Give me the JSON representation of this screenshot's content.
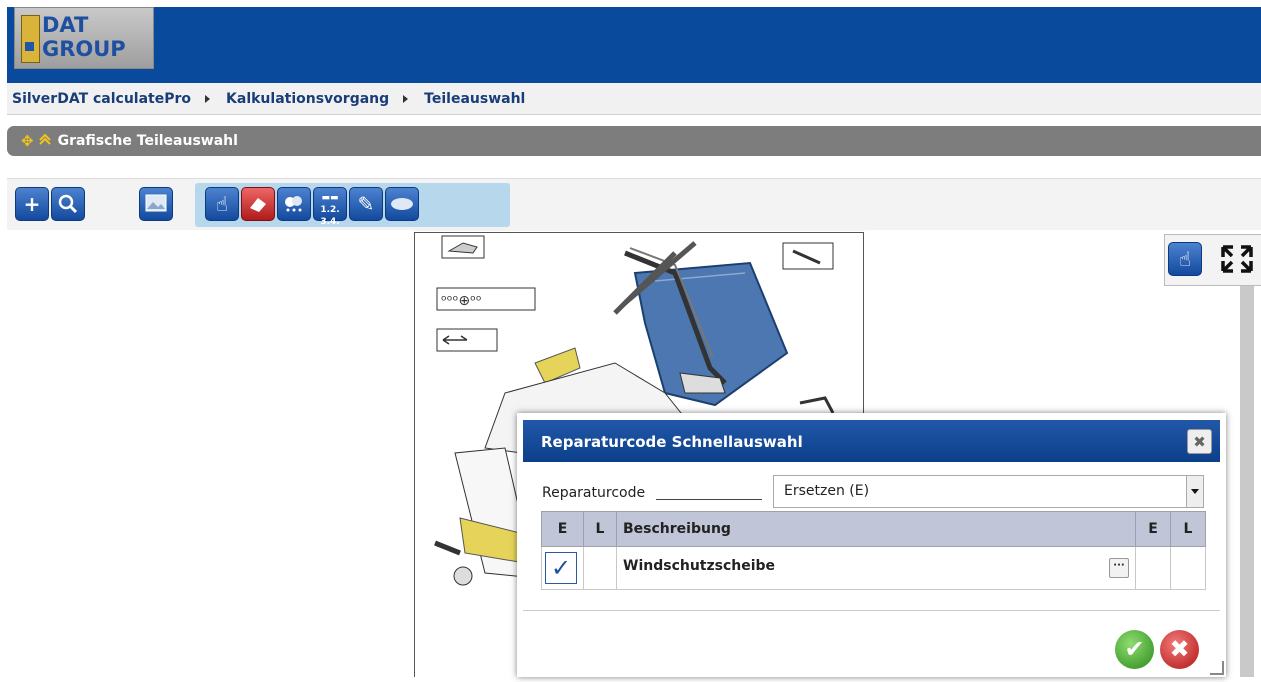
{
  "header": {
    "logo_line1": "DAT",
    "logo_line2": "GROUP"
  },
  "breadcrumb": [
    "SilverDAT calculatePro",
    "Kalkulationsvorgang",
    "Teileauswahl"
  ],
  "panel": {
    "title": "Grafische Teileauswahl"
  },
  "toolbar": {
    "buttons": [
      "add-icon",
      "search-icon",
      "image-icon",
      "hand-pointer-icon",
      "eraser-icon",
      "paint-icon",
      "numbered-list-icon",
      "tools-icon",
      "toggle-icon"
    ]
  },
  "view_tools": {
    "icons": [
      "hand-pointer-icon",
      "fullscreen-icon"
    ]
  },
  "colors": {
    "header_blue": "#0a4a9c",
    "panel_gray": "#7d7d7d",
    "accent_yellow": "#f0c419",
    "dialog_title": "#1a4f9e"
  },
  "dialog": {
    "title": "Reparaturcode Schnellauswahl",
    "repair_code_label": "Reparaturcode",
    "repair_code_value": "Ersetzen (E)",
    "table": {
      "headers": [
        "E",
        "L",
        "Beschreibung",
        "E",
        "L"
      ],
      "rows": [
        {
          "description": "Windschutzscheibe",
          "checked": true
        }
      ]
    }
  }
}
